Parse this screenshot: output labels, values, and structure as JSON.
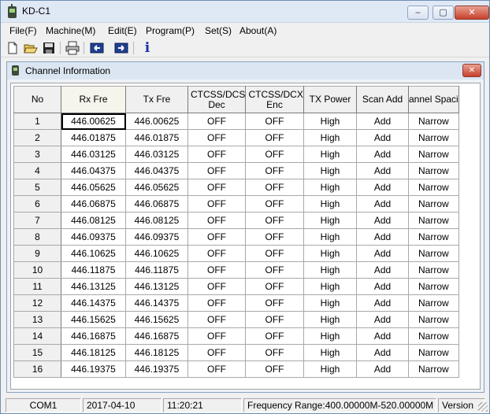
{
  "window": {
    "title": "KD-C1",
    "minimize": "‒",
    "maximize": "▢",
    "close": "✕"
  },
  "menu": [
    "File(F)",
    "Machine(M)",
    "Edit(E)",
    "Program(P)",
    "Set(S)",
    "About(A)"
  ],
  "toolbar": {
    "buttons": [
      "new-icon",
      "open-folder-icon",
      "save-icon",
      "print-icon",
      "read-radio-icon",
      "write-radio-icon",
      "info-icon"
    ],
    "info_glyph": "i"
  },
  "child_window": {
    "title": "Channel Information",
    "close": "✕"
  },
  "table": {
    "headers": [
      "No",
      "Rx Fre",
      "Tx Fre",
      "CTCSS/DCS Dec",
      "CTCSS/DCX Enc",
      "TX Power",
      "Scan Add",
      "annel Spaci"
    ],
    "rows": [
      {
        "no": "1",
        "rx": "446.00625",
        "tx": "446.00625",
        "dec": "OFF",
        "enc": "OFF",
        "power": "High",
        "scan": "Add",
        "spacing": "Narrow"
      },
      {
        "no": "2",
        "rx": "446.01875",
        "tx": "446.01875",
        "dec": "OFF",
        "enc": "OFF",
        "power": "High",
        "scan": "Add",
        "spacing": "Narrow"
      },
      {
        "no": "3",
        "rx": "446.03125",
        "tx": "446.03125",
        "dec": "OFF",
        "enc": "OFF",
        "power": "High",
        "scan": "Add",
        "spacing": "Narrow"
      },
      {
        "no": "4",
        "rx": "446.04375",
        "tx": "446.04375",
        "dec": "OFF",
        "enc": "OFF",
        "power": "High",
        "scan": "Add",
        "spacing": "Narrow"
      },
      {
        "no": "5",
        "rx": "446.05625",
        "tx": "446.05625",
        "dec": "OFF",
        "enc": "OFF",
        "power": "High",
        "scan": "Add",
        "spacing": "Narrow"
      },
      {
        "no": "6",
        "rx": "446.06875",
        "tx": "446.06875",
        "dec": "OFF",
        "enc": "OFF",
        "power": "High",
        "scan": "Add",
        "spacing": "Narrow"
      },
      {
        "no": "7",
        "rx": "446.08125",
        "tx": "446.08125",
        "dec": "OFF",
        "enc": "OFF",
        "power": "High",
        "scan": "Add",
        "spacing": "Narrow"
      },
      {
        "no": "8",
        "rx": "446.09375",
        "tx": "446.09375",
        "dec": "OFF",
        "enc": "OFF",
        "power": "High",
        "scan": "Add",
        "spacing": "Narrow"
      },
      {
        "no": "9",
        "rx": "446.10625",
        "tx": "446.10625",
        "dec": "OFF",
        "enc": "OFF",
        "power": "High",
        "scan": "Add",
        "spacing": "Narrow"
      },
      {
        "no": "10",
        "rx": "446.11875",
        "tx": "446.11875",
        "dec": "OFF",
        "enc": "OFF",
        "power": "High",
        "scan": "Add",
        "spacing": "Narrow"
      },
      {
        "no": "11",
        "rx": "446.13125",
        "tx": "446.13125",
        "dec": "OFF",
        "enc": "OFF",
        "power": "High",
        "scan": "Add",
        "spacing": "Narrow"
      },
      {
        "no": "12",
        "rx": "446.14375",
        "tx": "446.14375",
        "dec": "OFF",
        "enc": "OFF",
        "power": "High",
        "scan": "Add",
        "spacing": "Narrow"
      },
      {
        "no": "13",
        "rx": "446.15625",
        "tx": "446.15625",
        "dec": "OFF",
        "enc": "OFF",
        "power": "High",
        "scan": "Add",
        "spacing": "Narrow"
      },
      {
        "no": "14",
        "rx": "446.16875",
        "tx": "446.16875",
        "dec": "OFF",
        "enc": "OFF",
        "power": "High",
        "scan": "Add",
        "spacing": "Narrow"
      },
      {
        "no": "15",
        "rx": "446.18125",
        "tx": "446.18125",
        "dec": "OFF",
        "enc": "OFF",
        "power": "High",
        "scan": "Add",
        "spacing": "Narrow"
      },
      {
        "no": "16",
        "rx": "446.19375",
        "tx": "446.19375",
        "dec": "OFF",
        "enc": "OFF",
        "power": "High",
        "scan": "Add",
        "spacing": "Narrow"
      }
    ]
  },
  "status": {
    "port": "COM1",
    "date": "2017-04-10",
    "time": "11:20:21",
    "range": "Frequency Range:400.00000M-520.00000M",
    "version": "Version"
  }
}
